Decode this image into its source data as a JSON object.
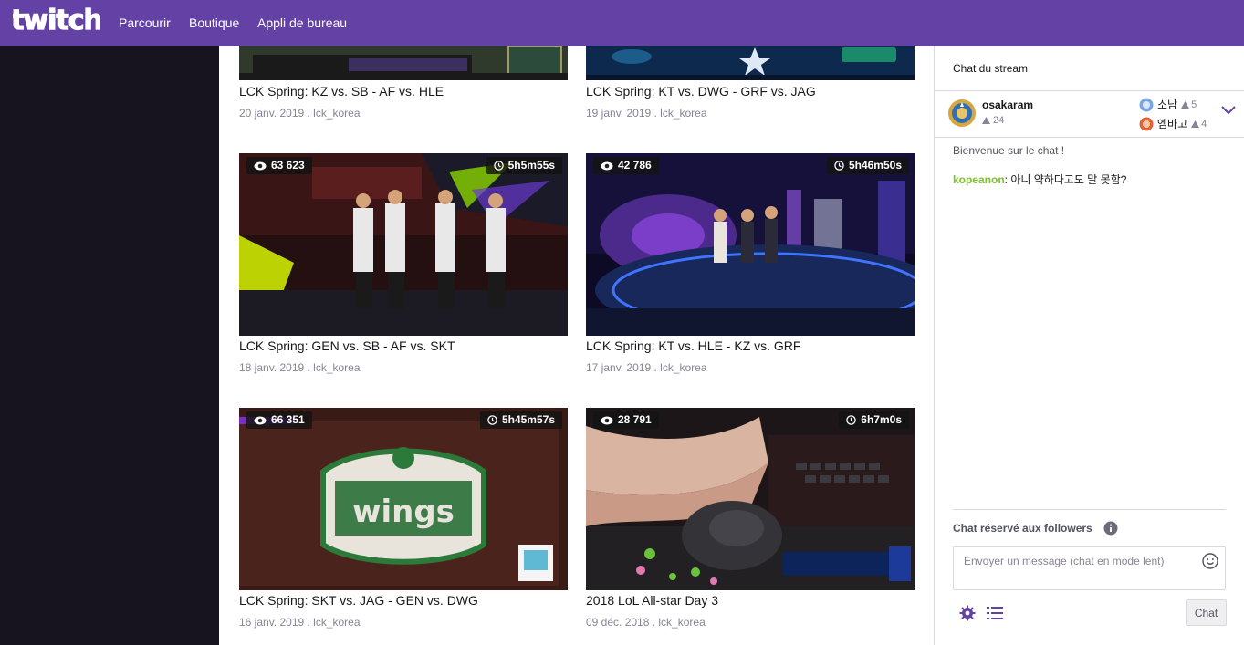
{
  "nav": {
    "logo": "twitch",
    "links": [
      "Parcourir",
      "Boutique",
      "Appli de bureau"
    ]
  },
  "videos": [
    {
      "title": "LCK Spring: KZ vs. SB - AF vs. HLE",
      "meta": "20 janv. 2019 . lck_korea",
      "views": "",
      "length": ""
    },
    {
      "title": "LCK Spring: KT vs. DWG - GRF vs. JAG",
      "meta": "19 janv. 2019 . lck_korea",
      "views": "",
      "length": ""
    },
    {
      "title": "LCK Spring: GEN vs. SB - AF vs. SKT",
      "meta": "18 janv. 2019 . lck_korea",
      "views": "63 623",
      "length": "5h5m55s"
    },
    {
      "title": "LCK Spring: KT vs. HLE - KZ vs. GRF",
      "meta": "17 janv. 2019 . lck_korea",
      "views": "42 786",
      "length": "5h46m50s"
    },
    {
      "title": "LCK Spring: SKT vs. JAG - GEN vs. DWG",
      "meta": "16 janv. 2019 . lck_korea",
      "views": "66 351",
      "length": "5h45m57s"
    },
    {
      "title": "2018 LoL All-star Day 3",
      "meta": "09 déc. 2018 . lck_korea",
      "views": "28 791",
      "length": "6h7m0s"
    }
  ],
  "chat": {
    "header": "Chat du stream",
    "top_user": {
      "name": "osakaram",
      "bits": "24"
    },
    "subs": [
      {
        "name": "소남",
        "count": "5"
      },
      {
        "name": "엠바고",
        "count": "4"
      }
    ],
    "welcome": "Bienvenue sur le chat !",
    "messages": [
      {
        "user": "kopeanon",
        "sep": ": ",
        "text": "아니 약하다고도 말 못함?"
      }
    ],
    "followers_label": "Chat réservé aux followers",
    "input_placeholder": "Envoyer un message (chat en mode lent)",
    "send_label": "Chat"
  },
  "colors": {
    "brand": "#6441a4",
    "username_green": "#7fc12c",
    "sidebar_dark": "#17141f"
  },
  "icons": [
    "twitch-logo",
    "eye-icon",
    "clock-icon",
    "crest-icon",
    "chevron-down-icon",
    "info-icon",
    "emoji-icon",
    "gear-icon",
    "list-icon"
  ]
}
